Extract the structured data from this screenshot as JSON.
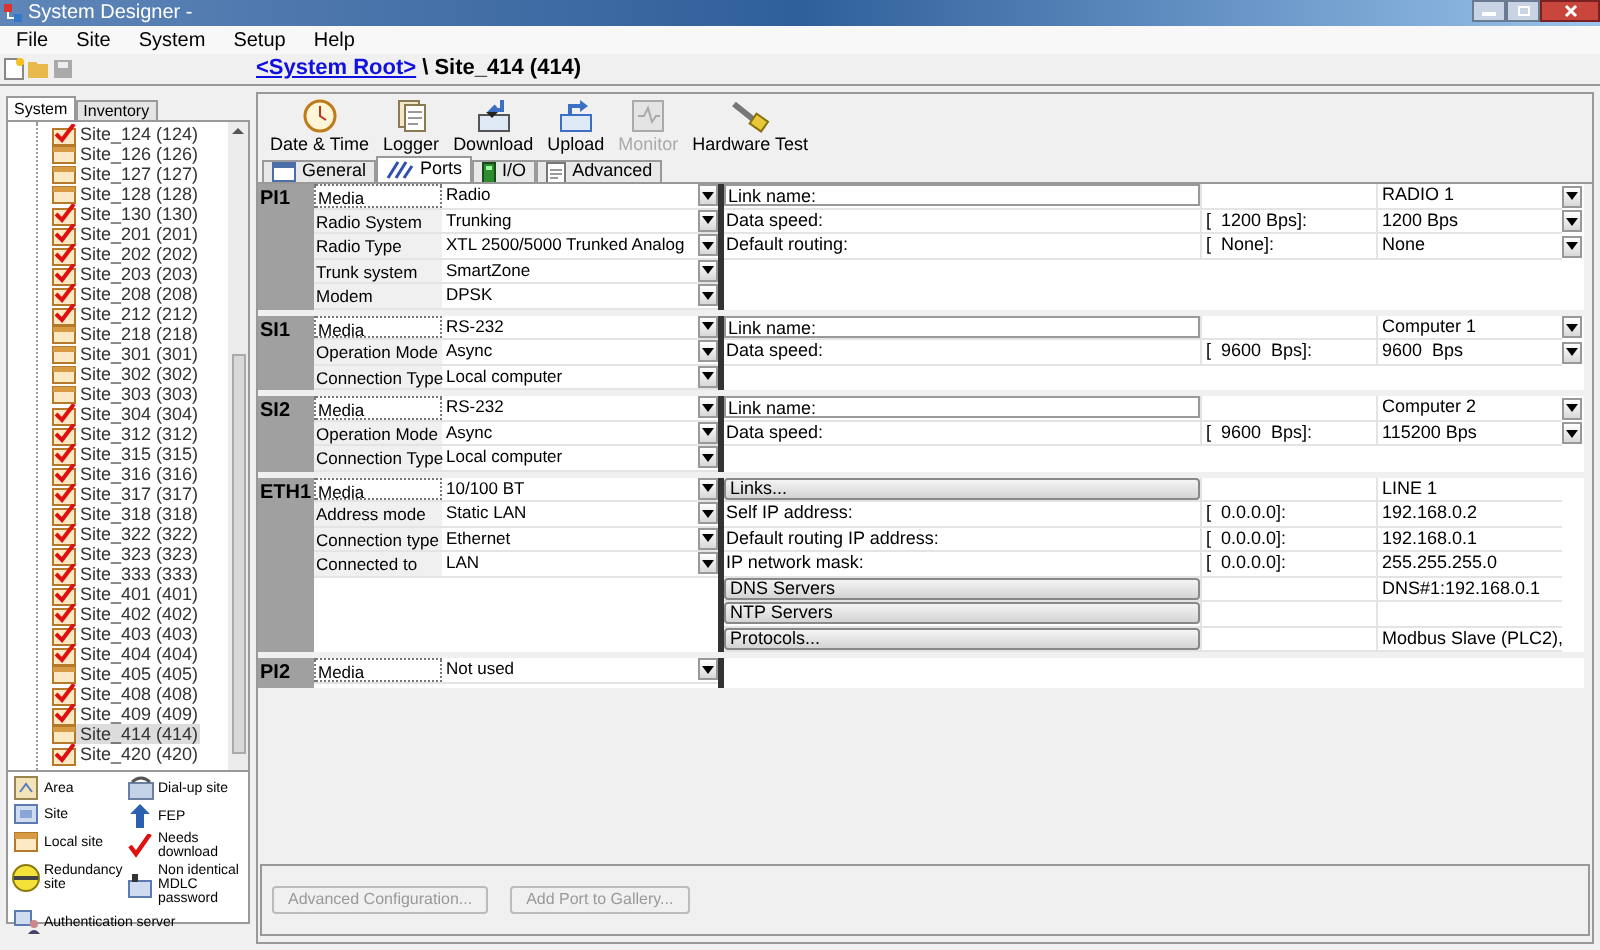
{
  "window": {
    "title": "System Designer -"
  },
  "menu": [
    "File",
    "Site",
    "System",
    "Setup",
    "Help"
  ],
  "breadcrumb": {
    "link": "<System Root>",
    "rest": "\\ Site_414 (414)"
  },
  "side_tabs": [
    {
      "label": "System",
      "selected": true
    },
    {
      "label": "Inventory",
      "selected": false
    }
  ],
  "tree": [
    {
      "label": "Site_124 (124)",
      "kind": "download",
      "selected": false
    },
    {
      "label": "Site_126 (126)",
      "kind": "local",
      "selected": false
    },
    {
      "label": "Site_127 (127)",
      "kind": "local",
      "selected": false
    },
    {
      "label": "Site_128 (128)",
      "kind": "local",
      "selected": false
    },
    {
      "label": "Site_130 (130)",
      "kind": "download",
      "selected": false
    },
    {
      "label": "Site_201 (201)",
      "kind": "download",
      "selected": false
    },
    {
      "label": "Site_202 (202)",
      "kind": "download",
      "selected": false
    },
    {
      "label": "Site_203 (203)",
      "kind": "download",
      "selected": false
    },
    {
      "label": "Site_208 (208)",
      "kind": "download",
      "selected": false
    },
    {
      "label": "Site_212 (212)",
      "kind": "download",
      "selected": false
    },
    {
      "label": "Site_218 (218)",
      "kind": "local",
      "selected": false
    },
    {
      "label": "Site_301 (301)",
      "kind": "local",
      "selected": false
    },
    {
      "label": "Site_302 (302)",
      "kind": "local",
      "selected": false
    },
    {
      "label": "Site_303 (303)",
      "kind": "local",
      "selected": false
    },
    {
      "label": "Site_304 (304)",
      "kind": "download",
      "selected": false
    },
    {
      "label": "Site_312 (312)",
      "kind": "download",
      "selected": false
    },
    {
      "label": "Site_315 (315)",
      "kind": "download",
      "selected": false
    },
    {
      "label": "Site_316 (316)",
      "kind": "download",
      "selected": false
    },
    {
      "label": "Site_317 (317)",
      "kind": "download",
      "selected": false
    },
    {
      "label": "Site_318 (318)",
      "kind": "download",
      "selected": false
    },
    {
      "label": "Site_322 (322)",
      "kind": "download",
      "selected": false
    },
    {
      "label": "Site_323 (323)",
      "kind": "download",
      "selected": false
    },
    {
      "label": "Site_333 (333)",
      "kind": "download",
      "selected": false
    },
    {
      "label": "Site_401 (401)",
      "kind": "download",
      "selected": false
    },
    {
      "label": "Site_402 (402)",
      "kind": "download",
      "selected": false
    },
    {
      "label": "Site_403 (403)",
      "kind": "download",
      "selected": false
    },
    {
      "label": "Site_404 (404)",
      "kind": "download",
      "selected": false
    },
    {
      "label": "Site_405 (405)",
      "kind": "local",
      "selected": false
    },
    {
      "label": "Site_408 (408)",
      "kind": "download",
      "selected": false
    },
    {
      "label": "Site_409 (409)",
      "kind": "download",
      "selected": false
    },
    {
      "label": "Site_414 (414)",
      "kind": "local",
      "selected": true
    },
    {
      "label": "Site_420 (420)",
      "kind": "download",
      "selected": false
    }
  ],
  "legend": [
    {
      "label": "Area",
      "kind": "area"
    },
    {
      "label": "Dial-up site",
      "kind": "dialup"
    },
    {
      "label": "Site",
      "kind": "site"
    },
    {
      "label": "FEP",
      "kind": "fep"
    },
    {
      "label": "Local site",
      "kind": "local"
    },
    {
      "label": "Needs download",
      "kind": "download"
    },
    {
      "label": "Redundancy site",
      "kind": "redundancy"
    },
    {
      "label": "Non identical MDLC password",
      "kind": "password"
    },
    {
      "label": "Authentication server",
      "kind": "auth"
    }
  ],
  "toolbar": [
    {
      "label": "Date & Time",
      "kind": "clock",
      "disabled": false
    },
    {
      "label": "Logger",
      "kind": "logger",
      "disabled": false
    },
    {
      "label": "Download",
      "kind": "download",
      "disabled": false
    },
    {
      "label": "Upload",
      "kind": "upload",
      "disabled": false
    },
    {
      "label": "Monitor",
      "kind": "monitor",
      "disabled": true
    },
    {
      "label": "Hardware Test",
      "kind": "hardware",
      "disabled": false
    }
  ],
  "tabs": [
    {
      "label": "General",
      "kind": "general",
      "selected": false
    },
    {
      "label": "Ports",
      "kind": "ports",
      "selected": true
    },
    {
      "label": "I/O",
      "kind": "io",
      "selected": false
    },
    {
      "label": "Advanced",
      "kind": "advanced",
      "selected": false
    }
  ],
  "ports": [
    {
      "label": "PI1",
      "settings": [
        {
          "name": "Media",
          "value": "Radio"
        },
        {
          "name": "Radio System",
          "value": "Trunking"
        },
        {
          "name": "Radio Type",
          "value": "XTL 2500/5000 Trunked Analog"
        },
        {
          "name": "Trunk system",
          "value": "SmartZone"
        },
        {
          "name": "Modem",
          "value": "DPSK"
        }
      ],
      "links": [
        {
          "kind": "field",
          "label": "Link name:",
          "value": "RADIO 1",
          "dropdown": true
        },
        {
          "kind": "text",
          "label": "Data speed:",
          "bracket": "[  1200 Bps]:",
          "value": "1200 Bps",
          "dropdown": true
        },
        {
          "kind": "text",
          "label": "Default routing:",
          "bracket": "[  None]:",
          "value": "None",
          "dropdown": true
        }
      ]
    },
    {
      "label": "SI1",
      "settings": [
        {
          "name": "Media",
          "value": "RS-232"
        },
        {
          "name": "Operation Mode",
          "value": "Async"
        },
        {
          "name": "Connection Type",
          "value": "Local computer"
        }
      ],
      "links": [
        {
          "kind": "field",
          "label": "Link name:",
          "value": "Computer 1",
          "dropdown": true
        },
        {
          "kind": "text",
          "label": "Data speed:",
          "bracket": "[  9600  Bps]:",
          "value": "9600  Bps",
          "dropdown": true
        }
      ]
    },
    {
      "label": "SI2",
      "settings": [
        {
          "name": "Media",
          "value": "RS-232"
        },
        {
          "name": "Operation Mode",
          "value": "Async"
        },
        {
          "name": "Connection Type",
          "value": "Local computer"
        }
      ],
      "links": [
        {
          "kind": "field",
          "label": "Link name:",
          "value": "Computer 2",
          "dropdown": true
        },
        {
          "kind": "text",
          "label": "Data speed:",
          "bracket": "[  9600  Bps]:",
          "value": "115200 Bps",
          "dropdown": true
        }
      ]
    },
    {
      "label": "ETH1",
      "settings": [
        {
          "name": "Media",
          "value": "10/100 BT"
        },
        {
          "name": "Address mode",
          "value": "Static LAN"
        },
        {
          "name": "Connection type",
          "value": "Ethernet"
        },
        {
          "name": "Connected to",
          "value": "LAN"
        }
      ],
      "links": [
        {
          "kind": "button",
          "label": "Links...",
          "value": "LINE 1",
          "dropdown": false
        },
        {
          "kind": "text",
          "label": "Self IP address:",
          "bracket": "[  0.0.0.0]:",
          "value": "192.168.0.2",
          "dropdown": false
        },
        {
          "kind": "text",
          "label": "Default routing IP address:",
          "bracket": "[  0.0.0.0]:",
          "value": "192.168.0.1",
          "dropdown": false
        },
        {
          "kind": "text",
          "label": "IP network mask:",
          "bracket": "[  0.0.0.0]:",
          "value": "255.255.255.0",
          "dropdown": false
        },
        {
          "kind": "button",
          "label": "DNS Servers",
          "value": "DNS#1:192.168.0.1",
          "dropdown": false
        },
        {
          "kind": "button",
          "label": "NTP Servers",
          "dropdown": false
        },
        {
          "kind": "button",
          "label": "Protocols...",
          "value": "Modbus Slave (PLC2),",
          "dropdown": false
        }
      ]
    },
    {
      "label": "PI2",
      "settings": [
        {
          "name": "Media",
          "value": "Not used"
        }
      ]
    }
  ],
  "bottom_buttons": [
    {
      "label": "Advanced Configuration...",
      "disabled": true
    },
    {
      "label": "Add Port to Gallery...",
      "disabled": true
    }
  ]
}
